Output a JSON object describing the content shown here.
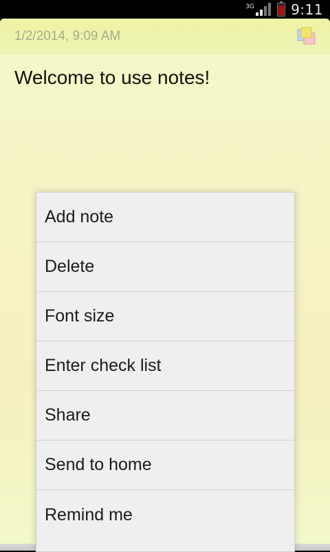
{
  "status_bar": {
    "network": "3G",
    "time": "9:11",
    "colors": {
      "background": "#000000",
      "text": "#e9e9e9",
      "battery_low": "#b01010"
    }
  },
  "note": {
    "date": "1/2/2014, 9:09 AM",
    "body": "Welcome to use notes!",
    "colors": {
      "paper": "#f3f6c6",
      "header": "#eef3a4",
      "date_text": "#a7ab8a"
    },
    "header_icon": "sticky-notes-icon"
  },
  "menu": {
    "items": [
      {
        "label": "Add note"
      },
      {
        "label": "Delete"
      },
      {
        "label": "Font size"
      },
      {
        "label": "Enter check list"
      },
      {
        "label": "Share"
      },
      {
        "label": "Send to home"
      },
      {
        "label": "Remind me"
      }
    ],
    "colors": {
      "background": "#efefef",
      "divider": "#d0d0d0",
      "text": "#1b1b1b"
    }
  }
}
